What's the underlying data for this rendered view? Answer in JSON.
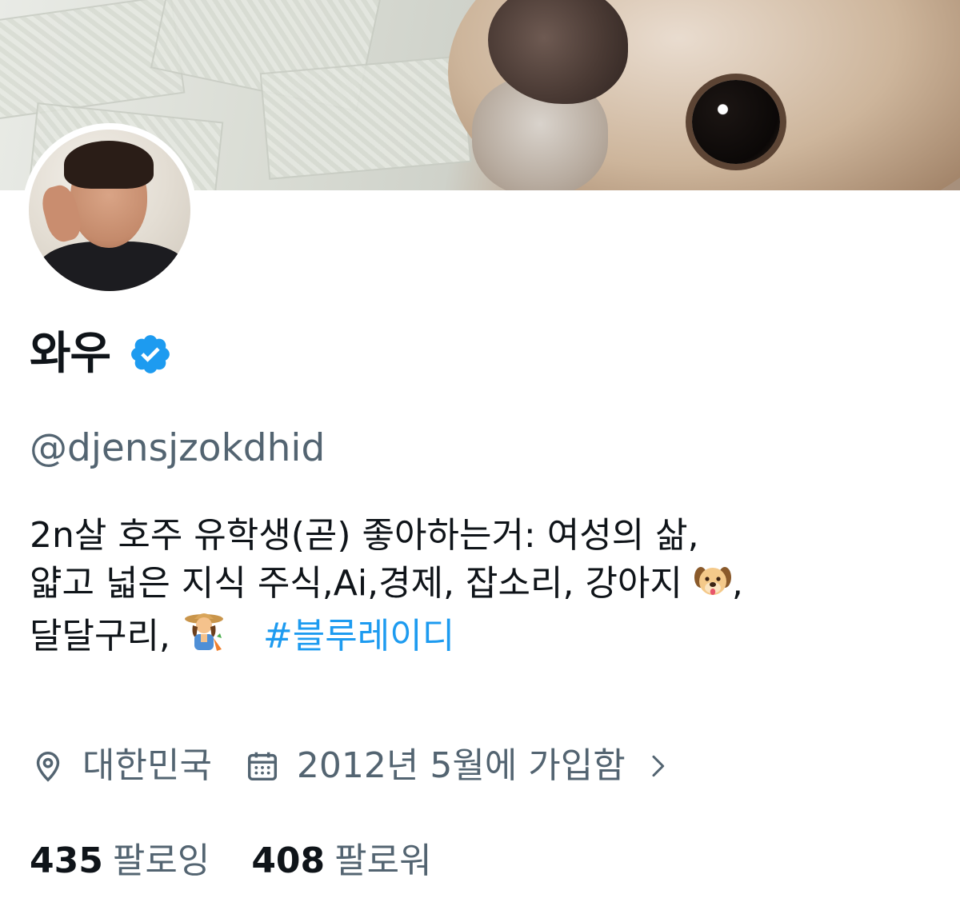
{
  "profile": {
    "display_name": "와우",
    "handle": "@djensjzokdhid",
    "bio_line1": "2n살 호주 유학생(곧) 좋아하는거: 여성의 삶,",
    "bio_line2_text": "얇고 넓은 지식 주식,Ai,경제, 잡소리, 강아지 ",
    "bio_line2_tail": ",",
    "bio_line3_text": "달달구리, ",
    "hashtag": "#블루레이디",
    "location": "대한민국",
    "joined": "2012년 5월에 가입함",
    "following_count": "435",
    "following_label": "팔로잉",
    "followers_count": "408",
    "followers_label": "팔로워"
  },
  "icons": {
    "verified": "verified-badge-icon",
    "location": "location-pin-icon",
    "calendar": "calendar-icon",
    "chevron": "chevron-right-icon",
    "dog_emoji": "dog-face-emoji",
    "farmer_emoji": "woman-farmer-emoji"
  },
  "colors": {
    "accent": "#1d9bf0",
    "secondary_text": "#536471",
    "primary_text": "#0f1419"
  }
}
